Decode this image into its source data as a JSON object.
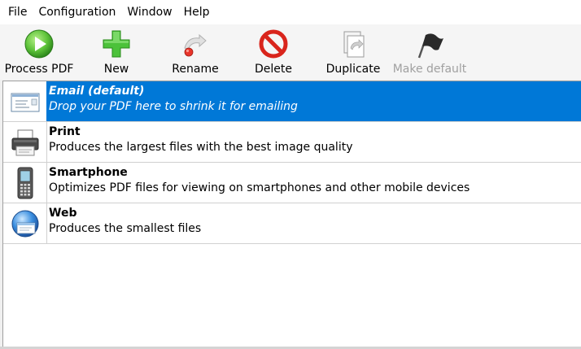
{
  "menu": {
    "items": [
      "File",
      "Configuration",
      "Window",
      "Help"
    ]
  },
  "toolbar": {
    "process_label": "Process PDF",
    "new_label": "New",
    "rename_label": "Rename",
    "delete_label": "Delete",
    "duplicate_label": "Duplicate",
    "make_default_label": "Make default"
  },
  "profiles": [
    {
      "title": "Email (default)",
      "description": "Drop your PDF here to shrink it for emailing",
      "icon": "email-icon",
      "selected": true
    },
    {
      "title": "Print",
      "description": "Produces the largest files with the best image quality",
      "icon": "printer-icon",
      "selected": false
    },
    {
      "title": "Smartphone",
      "description": "Optimizes PDF files for viewing on smartphones and other mobile devices",
      "icon": "smartphone-icon",
      "selected": false
    },
    {
      "title": "Web",
      "description": "Produces the smallest files",
      "icon": "globe-icon",
      "selected": false
    }
  ],
  "colors": {
    "selection": "#0078d7",
    "disabled_text": "#a0a0a0"
  }
}
